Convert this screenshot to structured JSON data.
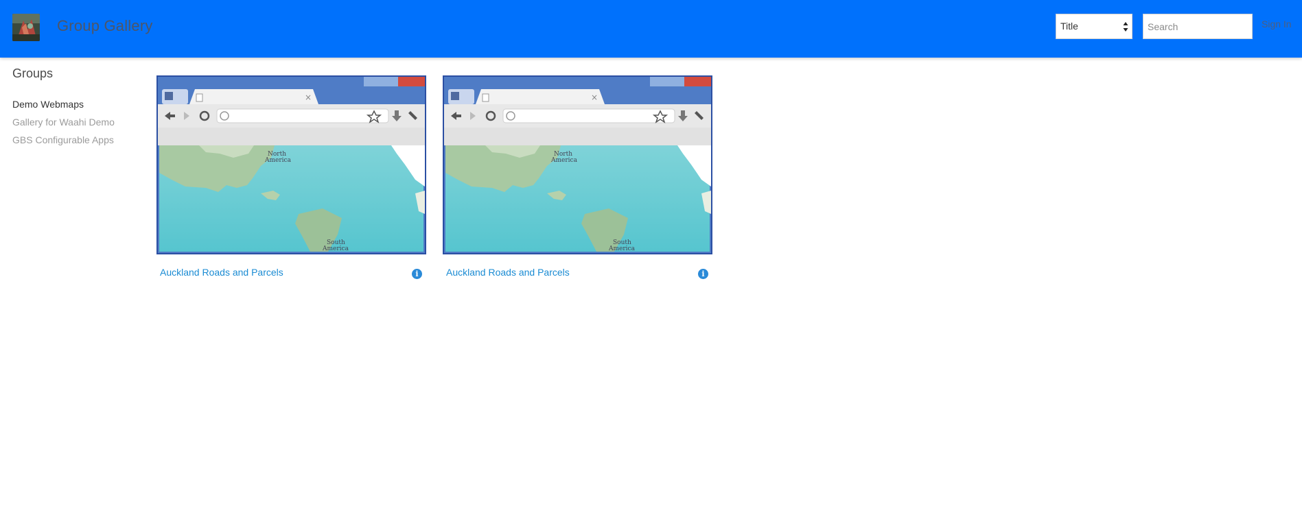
{
  "header": {
    "title": "Group Gallery",
    "sort_select": {
      "selected": "Title"
    },
    "search": {
      "placeholder": "Search"
    },
    "sign_in_label": "Sign In",
    "brand_color": "#0071fc"
  },
  "sidebar": {
    "heading": "Groups",
    "items": [
      {
        "label": "Demo Webmaps",
        "active": true
      },
      {
        "label": "Gallery for Waahi Demo",
        "active": false
      },
      {
        "label": "GBS Configurable Apps",
        "active": false
      }
    ]
  },
  "gallery": {
    "items": [
      {
        "title": "Auckland Roads and Parcels",
        "thumbnail_icon": "browser-map-thumbnail",
        "info_icon": "info-icon",
        "info_glyph": "i"
      },
      {
        "title": "Auckland Roads and Parcels",
        "thumbnail_icon": "browser-map-thumbnail",
        "info_icon": "info-icon",
        "info_glyph": "i"
      }
    ],
    "link_color": "#1a8bd3"
  }
}
